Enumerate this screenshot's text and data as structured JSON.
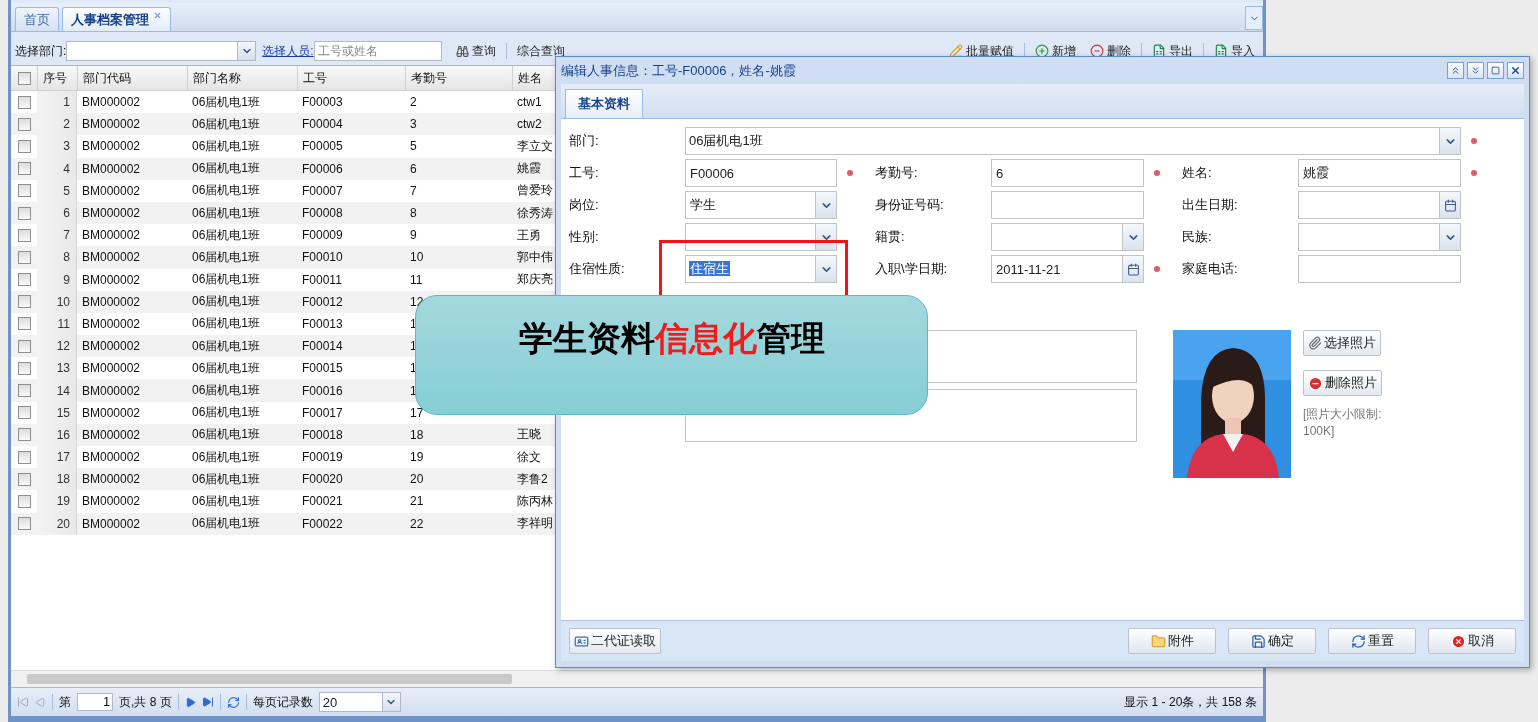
{
  "tabs": [
    {
      "label": "首页",
      "selected": false,
      "closable": false
    },
    {
      "label": "人事档案管理",
      "selected": true,
      "closable": true
    }
  ],
  "toolbar": {
    "dept_label": "选择部门:",
    "person_link": "选择人员:",
    "person_placeholder": "工号或姓名",
    "search_button": "查询",
    "advanced_search": "综合查询",
    "actions": [
      {
        "label": "批量赋值",
        "kind": "batch"
      },
      {
        "label": "新增",
        "kind": "add"
      },
      {
        "label": "删除",
        "kind": "delete"
      },
      {
        "label": "导出",
        "kind": "export"
      },
      {
        "label": "导入",
        "kind": "import"
      }
    ]
  },
  "grid": {
    "header_checked": false,
    "columns": [
      "序号",
      "部门代码",
      "部门名称",
      "工号",
      "考勤号",
      "姓名"
    ],
    "rows": [
      {
        "no": "1",
        "dept_code": "BM000002",
        "dept_name": "06届机电1班",
        "emp_no": "F00003",
        "att_no": "2",
        "name": "ctw1",
        "checked": false
      },
      {
        "no": "2",
        "dept_code": "BM000002",
        "dept_name": "06届机电1班",
        "emp_no": "F00004",
        "att_no": "3",
        "name": "ctw2",
        "checked": false
      },
      {
        "no": "3",
        "dept_code": "BM000002",
        "dept_name": "06届机电1班",
        "emp_no": "F00005",
        "att_no": "5",
        "name": "李立文",
        "checked": false
      },
      {
        "no": "4",
        "dept_code": "BM000002",
        "dept_name": "06届机电1班",
        "emp_no": "F00006",
        "att_no": "6",
        "name": "姚霞",
        "checked": false
      },
      {
        "no": "5",
        "dept_code": "BM000002",
        "dept_name": "06届机电1班",
        "emp_no": "F00007",
        "att_no": "7",
        "name": "曾爱玲",
        "checked": false
      },
      {
        "no": "6",
        "dept_code": "BM000002",
        "dept_name": "06届机电1班",
        "emp_no": "F00008",
        "att_no": "8",
        "name": "徐秀涛",
        "checked": false
      },
      {
        "no": "7",
        "dept_code": "BM000002",
        "dept_name": "06届机电1班",
        "emp_no": "F00009",
        "att_no": "9",
        "name": "王勇",
        "checked": false
      },
      {
        "no": "8",
        "dept_code": "BM000002",
        "dept_name": "06届机电1班",
        "emp_no": "F00010",
        "att_no": "10",
        "name": "郭中伟",
        "checked": false
      },
      {
        "no": "9",
        "dept_code": "BM000002",
        "dept_name": "06届机电1班",
        "emp_no": "F00011",
        "att_no": "11",
        "name": "郑庆亮",
        "checked": false
      },
      {
        "no": "10",
        "dept_code": "BM000002",
        "dept_name": "06届机电1班",
        "emp_no": "F00012",
        "att_no": "12",
        "checked": false
      },
      {
        "no": "11",
        "dept_code": "BM000002",
        "dept_name": "06届机电1班",
        "emp_no": "F00013",
        "att_no": "1",
        "checked": false
      },
      {
        "no": "12",
        "dept_code": "BM000002",
        "dept_name": "06届机电1班",
        "emp_no": "F00014",
        "att_no": "1",
        "checked": false
      },
      {
        "no": "13",
        "dept_code": "BM000002",
        "dept_name": "06届机电1班",
        "emp_no": "F00015",
        "att_no": "1",
        "checked": false
      },
      {
        "no": "14",
        "dept_code": "BM000002",
        "dept_name": "06届机电1班",
        "emp_no": "F00016",
        "att_no": "1",
        "checked": false
      },
      {
        "no": "15",
        "dept_code": "BM000002",
        "dept_name": "06届机电1班",
        "emp_no": "F00017",
        "att_no": "17",
        "checked": false
      },
      {
        "no": "16",
        "dept_code": "BM000002",
        "dept_name": "06届机电1班",
        "emp_no": "F00018",
        "att_no": "18",
        "name": "王晓",
        "checked": false
      },
      {
        "no": "17",
        "dept_code": "BM000002",
        "dept_name": "06届机电1班",
        "emp_no": "F00019",
        "att_no": "19",
        "name": "徐文",
        "checked": false
      },
      {
        "no": "18",
        "dept_code": "BM000002",
        "dept_name": "06届机电1班",
        "emp_no": "F00020",
        "att_no": "20",
        "name": "李鲁2",
        "checked": false
      },
      {
        "no": "19",
        "dept_code": "BM000002",
        "dept_name": "06届机电1班",
        "emp_no": "F00021",
        "att_no": "21",
        "name": "陈丙林",
        "checked": false
      },
      {
        "no": "20",
        "dept_code": "BM000002",
        "dept_name": "06届机电1班",
        "emp_no": "F00022",
        "att_no": "22",
        "name": "李祥明",
        "checked": false
      }
    ]
  },
  "pager": {
    "page_label": "第",
    "page": "1",
    "page_total": "页,共 8 页",
    "page_size_label": "每页记录数",
    "page_size": "20",
    "summary": "显示 1 - 20条，共 158 条"
  },
  "dialog": {
    "title": "编辑人事信息：工号-F00006，姓名-姚霞",
    "tabs": [
      {
        "label": "基本资料",
        "selected": true
      }
    ],
    "department": {
      "label": "部门:",
      "value": "06届机电1班",
      "required": true
    },
    "fields": [
      {
        "label": "工号:",
        "kind": "text",
        "value": "F00006",
        "required": true
      },
      {
        "label": "考勤号:",
        "kind": "text",
        "value": "6",
        "required": true
      },
      {
        "label": "姓名:",
        "kind": "text",
        "value": "姚霞",
        "required": true
      },
      {
        "label": "岗位:",
        "kind": "combo",
        "value": "学生",
        "required": false
      },
      {
        "label": "身份证号码:",
        "kind": "text",
        "required": false
      },
      {
        "label": "出生日期:",
        "kind": "date",
        "required": false
      },
      {
        "label": "性别:",
        "kind": "combo",
        "required": false
      },
      {
        "label": "籍贯:",
        "kind": "combo",
        "required": false
      },
      {
        "label": "民族:",
        "kind": "combo",
        "required": false
      },
      {
        "label": "住宿性质:",
        "kind": "combo",
        "value": "住宿生",
        "value_selected": true,
        "required": false
      },
      {
        "label": "入职\\学日期:",
        "kind": "date",
        "value": "2011-11-21",
        "required": true
      },
      {
        "label": "家庭电话:",
        "kind": "text",
        "required": false
      }
    ],
    "memo_fields": [
      {
        "kind": "textarea"
      },
      {
        "kind": "textarea"
      }
    ],
    "photo_buttons": [
      {
        "label": "选择照片",
        "kind": "attach"
      },
      {
        "label": "删除照片",
        "kind": "remove"
      }
    ],
    "photo_note": "[照片大小限制: 100K]",
    "id_reader_button": "二代证读取",
    "footer_buttons": [
      {
        "label": "附件",
        "kind": "attachment"
      },
      {
        "label": "确定",
        "kind": "save"
      },
      {
        "label": "重置",
        "kind": "reset"
      },
      {
        "label": "取消",
        "kind": "cancel"
      }
    ]
  },
  "callout": {
    "text_before": "学生资料",
    "highlight": "信息化",
    "text_after": "管理"
  }
}
